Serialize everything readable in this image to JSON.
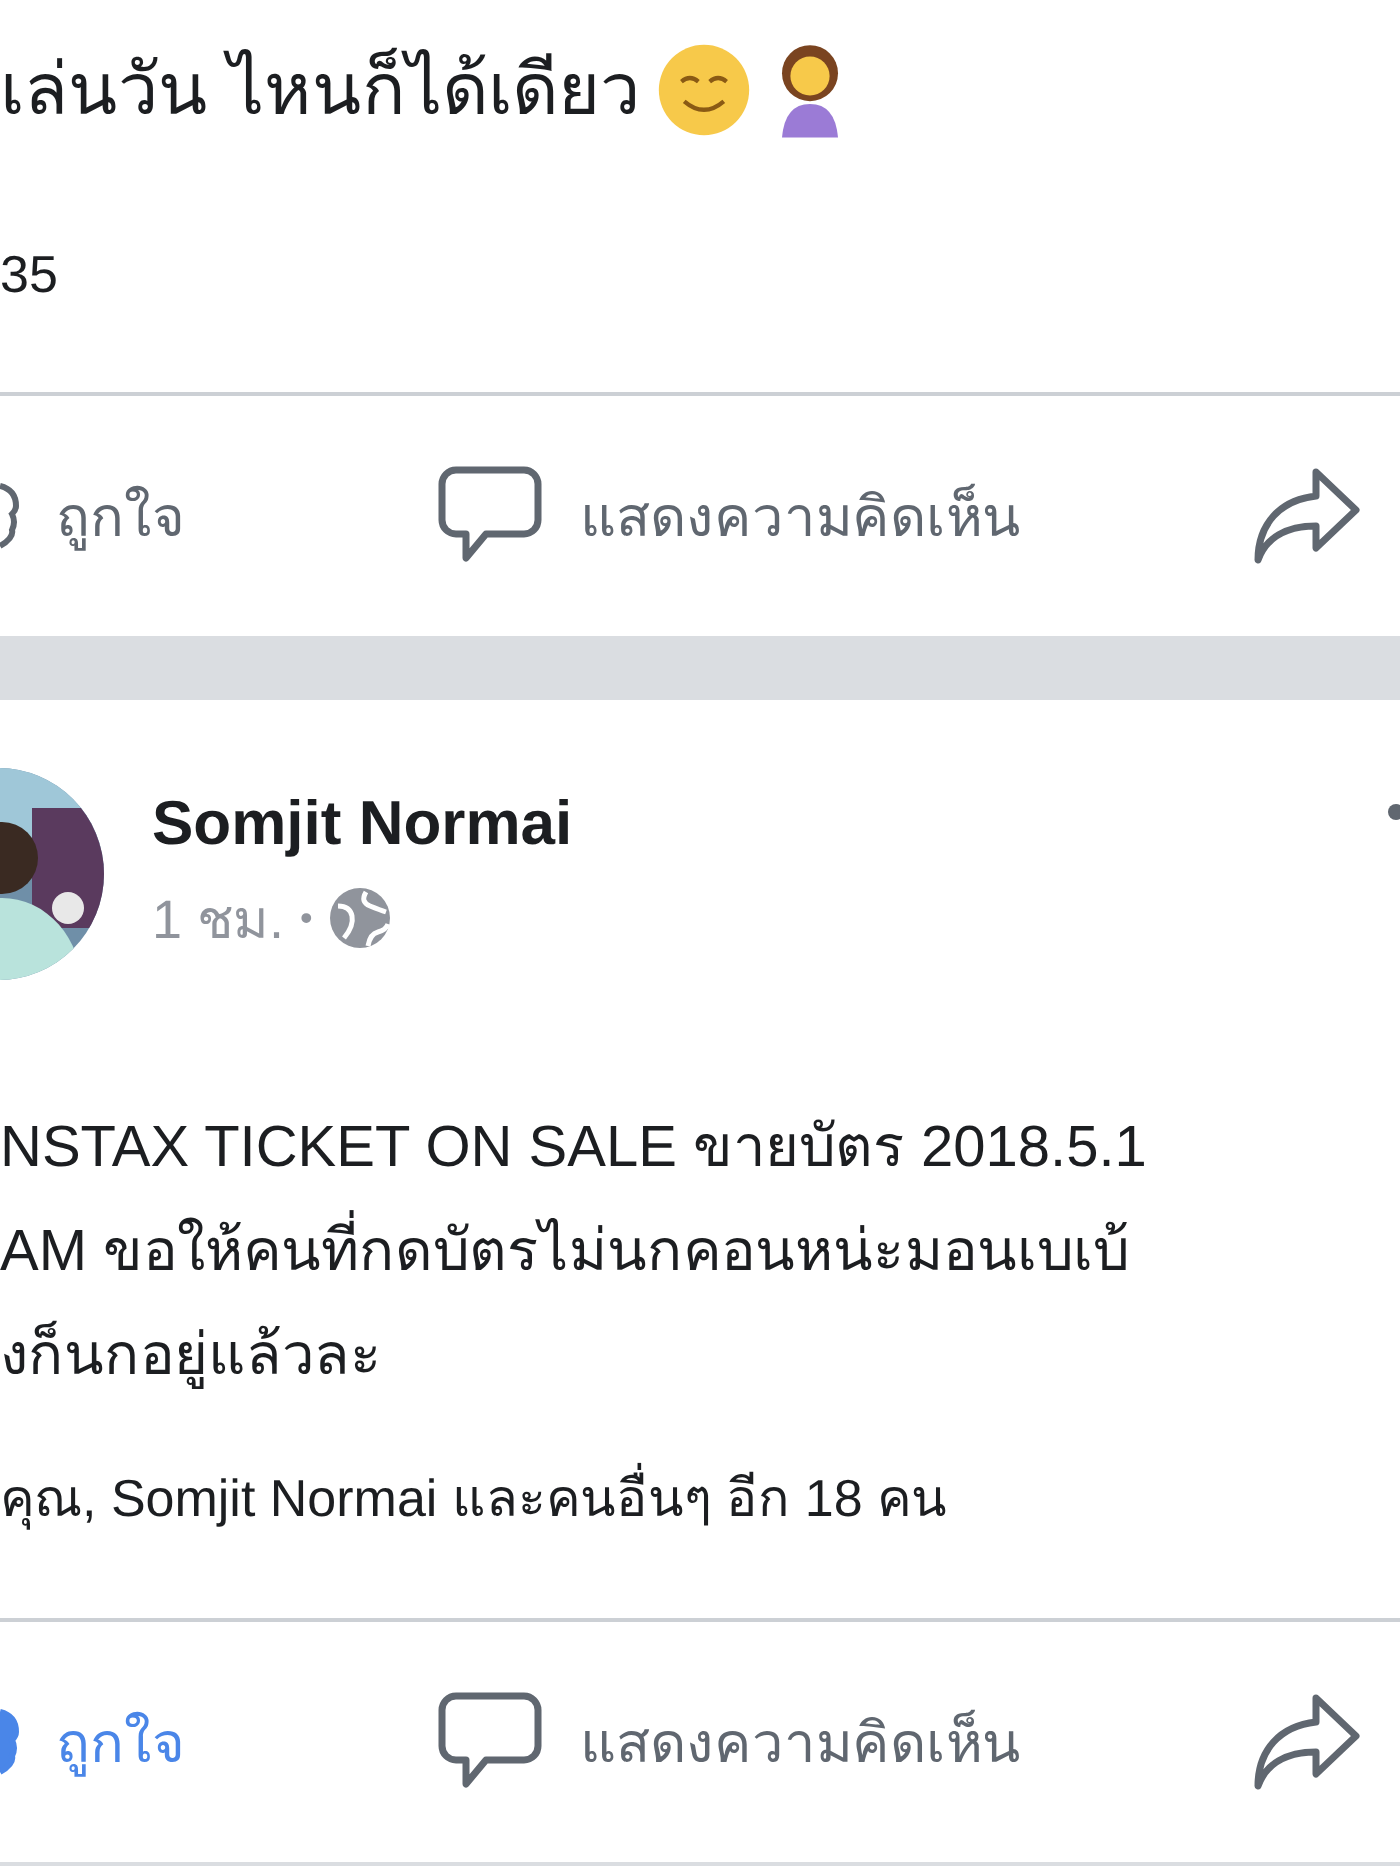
{
  "posts": [
    {
      "kind": "tail",
      "text": "เล่นวัน ไหนก็ได้เดียว",
      "reaction_count": "35",
      "actions": [
        {
          "kind": "like",
          "label": "ถูกใจ",
          "selected": false
        },
        {
          "kind": "comment",
          "label": "แสดงความคิดเห็น"
        },
        {
          "kind": "share"
        }
      ]
    },
    {
      "kind": "full",
      "author": "Somjit Normai",
      "time": "1 ชม.",
      "separator": "•",
      "body": [
        "NSTAX TICKET ON SALE ขายบัตร 2018.5.1",
        "AM ขอให้คนที่กดบัตรไม่นกคอนหน่ะมอนเบเบ้",
        "งก็นกอยู่แล้วละ"
      ],
      "reactions_summary": "คุณ, Somjit Normai และคนอื่นๆ อีก 18 คน",
      "actions": [
        {
          "kind": "like",
          "label": "ถูกใจ",
          "selected": true
        },
        {
          "kind": "comment",
          "label": "แสดงความคิดเห็น"
        },
        {
          "kind": "share"
        }
      ]
    }
  ]
}
